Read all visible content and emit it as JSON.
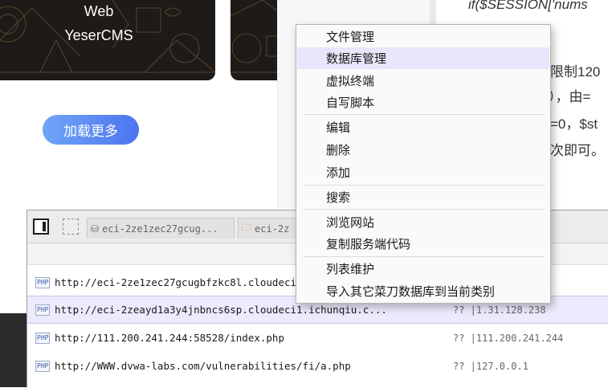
{
  "cards": {
    "web_label": "Web",
    "cms_label": "YeserCMS"
  },
  "load_more_button": "加载更多",
  "article": {
    "line1": "if($SESSION['nums",
    "line2": "限制120",
    "line3": "），由=",
    "line4": "=0，$st",
    "line5": "次即可。"
  },
  "context_menu": {
    "items": [
      "文件管理",
      "数据库管理",
      "虚拟终端",
      "自写脚本",
      "编辑",
      "删除",
      "添加",
      "搜索",
      "浏览网站",
      "复制服务端代码",
      "列表维护",
      "导入其它菜刀数据库到当前类别"
    ],
    "highlighted_index": 1
  },
  "chopper": {
    "tabs": [
      {
        "label": "eci-2ze1zec27gcug...",
        "icon": "database-icon"
      },
      {
        "label": "eci-2z",
        "icon": "folder-icon"
      }
    ],
    "rows": [
      {
        "badge": "PHP",
        "url": "http://eci-2ze1zec27gcugbfzkc8l.cloudeci",
        "ip": ""
      },
      {
        "badge": "PHP",
        "url": "http://eci-2zeayd1a3y4jnbncs6sp.cloudeci1.ichunqiu.c...",
        "ip": "?? |1.31.128.238"
      },
      {
        "badge": "PHP",
        "url": "http://111.200.241.244:58528/index.php",
        "ip": "?? |111.200.241.244"
      },
      {
        "badge": "PHP",
        "url": "http://WWW.dvwa-labs.com/vulnerabilities/fi/a.php",
        "ip": "?? |127.0.0.1"
      }
    ],
    "selected_row": 1
  },
  "colors": {
    "menu_highlight": "#e8e6fb",
    "button_gradient_start": "#6fa6f5",
    "button_gradient_end": "#4d74f0",
    "card_bg": "#1e1a17"
  }
}
